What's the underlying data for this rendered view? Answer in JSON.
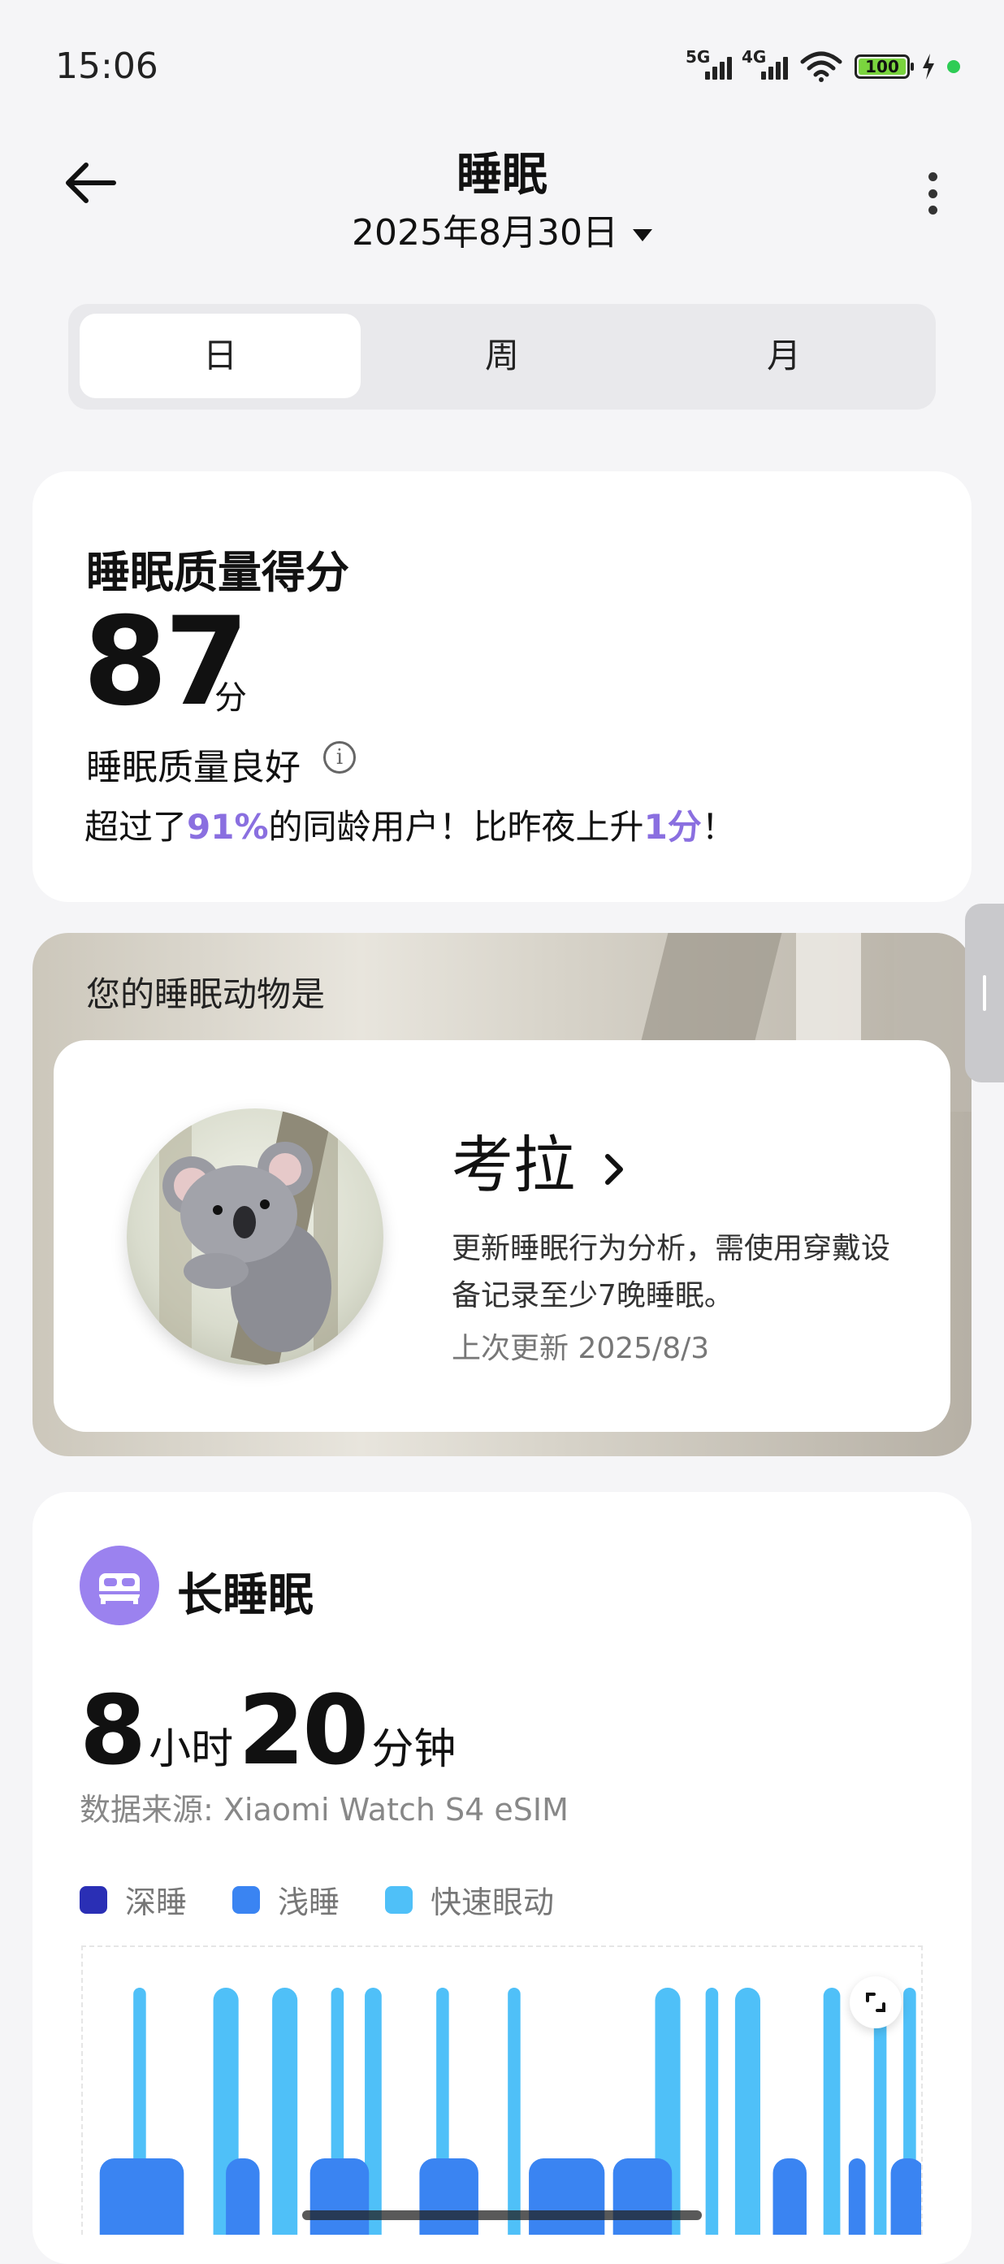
{
  "status_bar": {
    "time": "15:06",
    "network1": "5G",
    "network2": "4G",
    "battery": "100"
  },
  "header": {
    "title": "睡眠",
    "date": "2025年8月30日"
  },
  "tabs": [
    {
      "label": "日",
      "active": true
    },
    {
      "label": "周",
      "active": false
    },
    {
      "label": "月",
      "active": false
    }
  ],
  "score": {
    "title": "睡眠质量得分",
    "value": "87",
    "unit": "分",
    "quality": "睡眠质量良好",
    "compare_prefix": "超过了",
    "compare_percent": "91%",
    "compare_mid": "的同龄用户！比昨夜上升",
    "compare_delta": "1分",
    "compare_suffix": "！"
  },
  "animal": {
    "label": "您的睡眠动物是",
    "name": "考拉",
    "description": "更新睡眠行为分析，需使用穿戴设备记录至少7晚睡眠。",
    "last_update": "上次更新 2025/8/3"
  },
  "sleep": {
    "title": "长睡眠",
    "hours": "8",
    "hours_unit": "小时",
    "minutes": "20",
    "minutes_unit": "分钟",
    "source": "数据来源: Xiaomi Watch S4 eSIM",
    "legend": [
      {
        "label": "深睡",
        "color": "#2a2fb5"
      },
      {
        "label": "浅睡",
        "color": "#3a84f2"
      },
      {
        "label": "快速眼动",
        "color": "#4fc0f8"
      }
    ]
  },
  "chart_data": {
    "type": "bar",
    "series": [
      {
        "name": "快速眼动",
        "values": [
          [
            0.06,
            0.075
          ],
          [
            0.155,
            0.185
          ],
          [
            0.225,
            0.255
          ],
          [
            0.295,
            0.31
          ],
          [
            0.335,
            0.355
          ],
          [
            0.42,
            0.435
          ],
          [
            0.505,
            0.52
          ],
          [
            0.68,
            0.71
          ],
          [
            0.74,
            0.755
          ],
          [
            0.775,
            0.805
          ],
          [
            0.88,
            0.9
          ],
          [
            0.94,
            0.955
          ],
          [
            0.975,
            0.99
          ]
        ]
      },
      {
        "name": "浅睡",
        "values": [
          [
            0.02,
            0.12
          ],
          [
            0.17,
            0.21
          ],
          [
            0.27,
            0.34
          ],
          [
            0.4,
            0.47
          ],
          [
            0.53,
            0.62
          ],
          [
            0.63,
            0.7
          ],
          [
            0.82,
            0.86
          ],
          [
            0.91,
            0.93
          ],
          [
            0.96,
            1.0
          ]
        ]
      },
      {
        "name": "深睡",
        "values": []
      }
    ]
  }
}
